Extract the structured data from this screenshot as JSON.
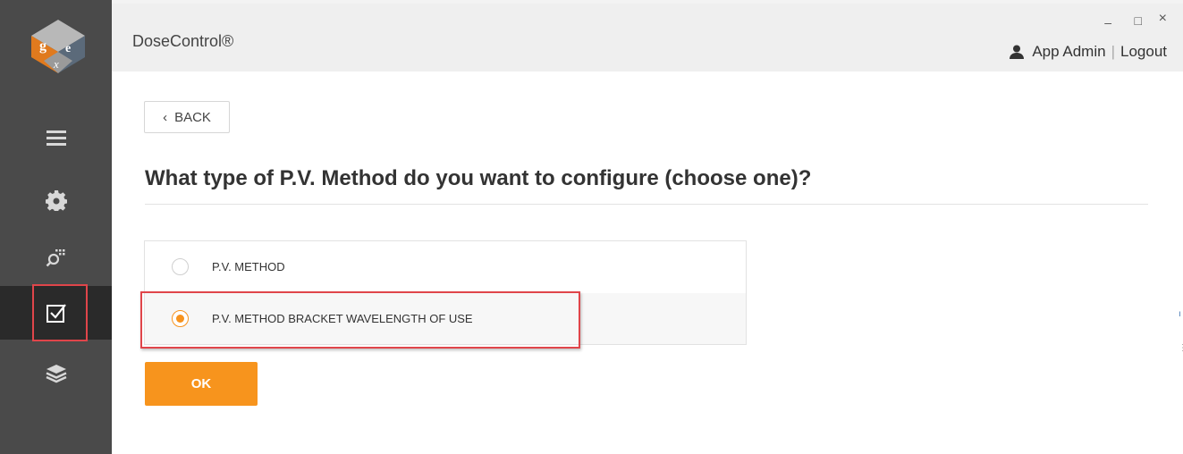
{
  "app": {
    "title": "DoseControl®"
  },
  "window_controls": {
    "minimize": "–",
    "maximize": "□",
    "close": "×"
  },
  "user": {
    "name": "App Admin",
    "separator": "|",
    "logout": "Logout",
    "icon": "user-icon"
  },
  "sidebar": {
    "logo": "gex-logo",
    "items": [
      {
        "icon": "menu-icon",
        "active": false
      },
      {
        "icon": "gear-icon",
        "active": false
      },
      {
        "icon": "search-grid-icon",
        "active": false
      },
      {
        "icon": "checkbox-icon",
        "active": true
      },
      {
        "icon": "layers-icon",
        "active": false
      }
    ]
  },
  "page": {
    "back_label": "BACK",
    "question": "What type of P.V. Method do you want to configure (choose one)?",
    "options": [
      {
        "label": "P.V. METHOD",
        "selected": false
      },
      {
        "label": "P.V. METHOD BRACKET WAVELENGTH OF USE",
        "selected": true
      }
    ],
    "ok_label": "OK"
  },
  "colors": {
    "accent": "#f7941d",
    "sidebar": "#4a4a4a",
    "sidebar_active": "#2a2a2a",
    "highlight": "#e0454a"
  }
}
